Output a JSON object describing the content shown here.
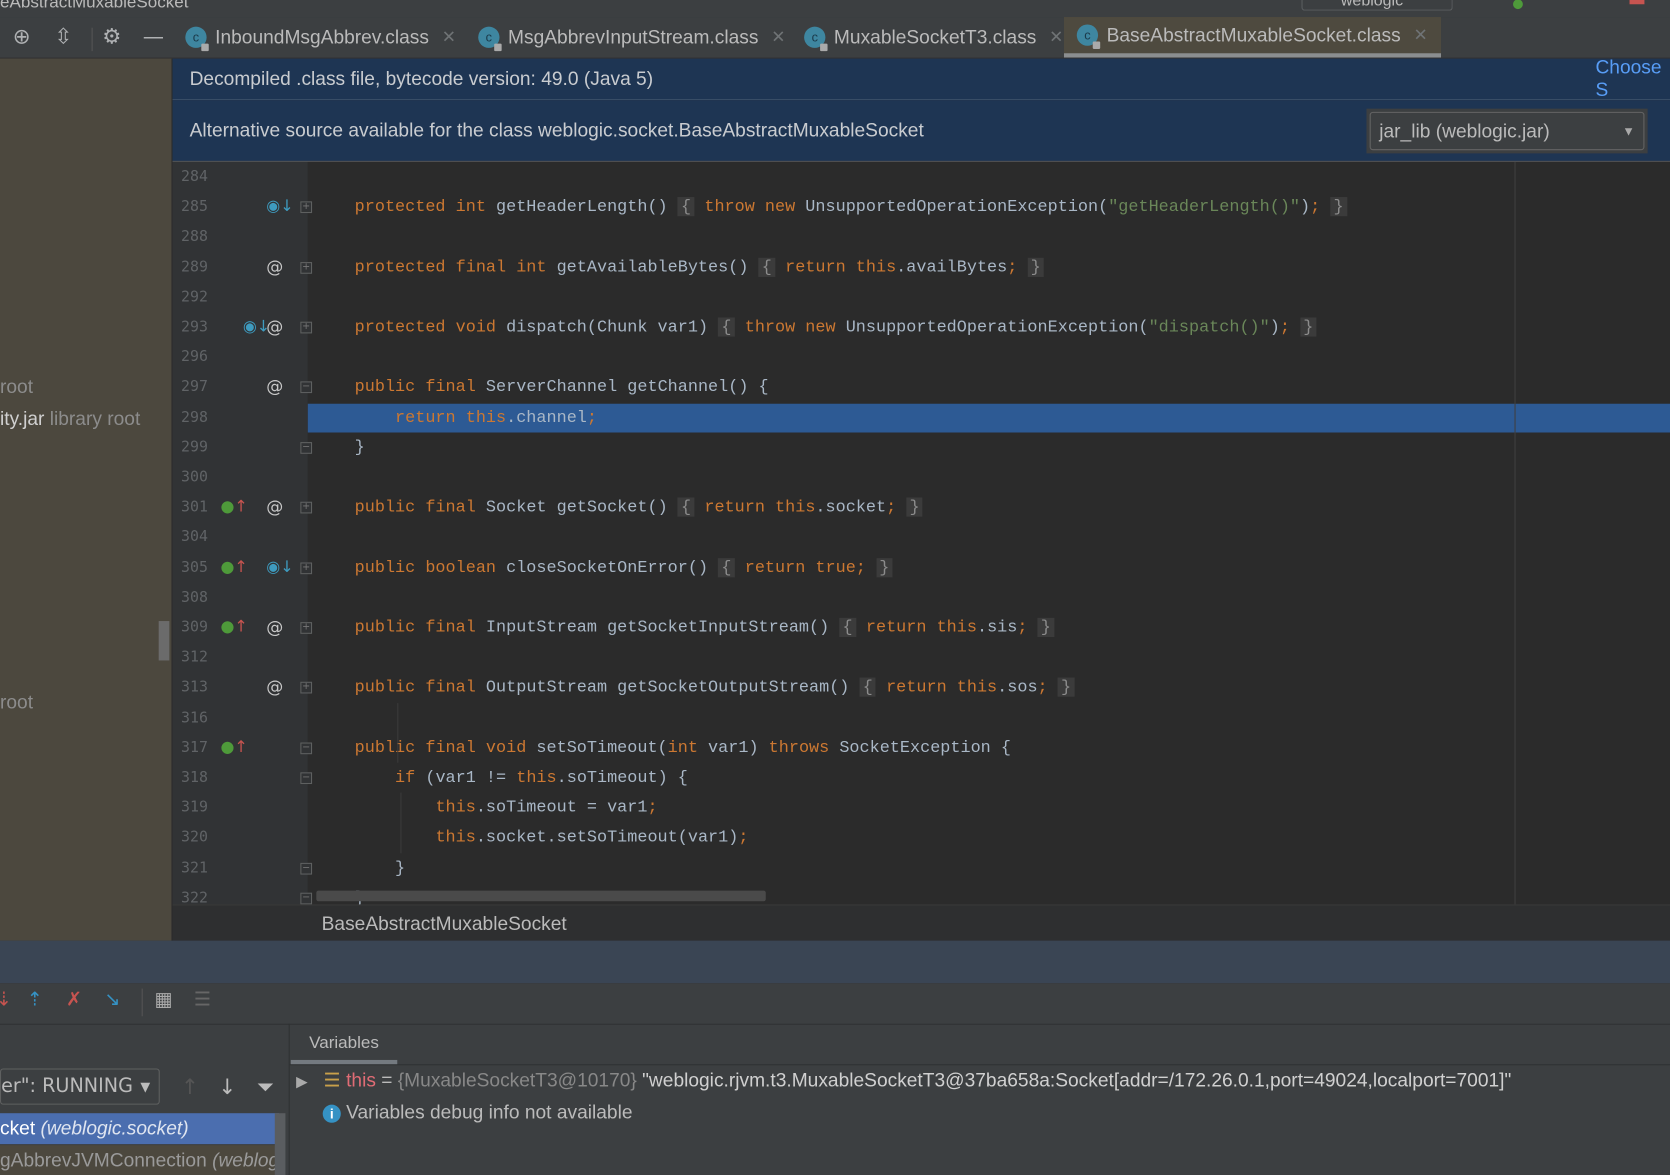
{
  "window": {
    "title": "eAbstractMuxableSocket",
    "run_config": "weblogic"
  },
  "toolbar_left": {
    "icons": [
      "locate-icon",
      "collapse-icon",
      "gear-icon",
      "minimize-icon"
    ]
  },
  "tabs": [
    {
      "label": "InboundMsgAbbrev.class",
      "active": false
    },
    {
      "label": "MsgAbbrevInputStream.class",
      "active": false
    },
    {
      "label": "MuxableSocketT3.class",
      "active": false
    },
    {
      "label": "BaseAbstractMuxableSocket.class",
      "active": true
    }
  ],
  "banner": {
    "decompiled": "Decompiled .class file, bytecode version: 49.0 (Java 5)",
    "choose_link": "Choose S",
    "alternative": "Alternative source available for the class weblogic.socket.BaseAbstractMuxableSocket",
    "source_select": "jar_lib (weblogic.jar)"
  },
  "project_tree": [
    {
      "name": "root",
      "suffix": ""
    },
    {
      "name": "ity.jar",
      "suffix": "library root"
    },
    {
      "name": "root",
      "suffix": ""
    }
  ],
  "code": [
    {
      "n": "284",
      "t": []
    },
    {
      "n": "285",
      "t": [
        [
          "kw",
          "protected int "
        ],
        [
          "pl",
          "getHeaderLength() "
        ],
        [
          "fb",
          "{"
        ],
        [
          "kw",
          " throw new "
        ],
        [
          "pl",
          "UnsupportedOperationException("
        ],
        [
          "str",
          "\"getHeaderLength()\""
        ],
        [
          "pl",
          ")"
        ],
        [
          "kw",
          ";"
        ],
        [
          "pl",
          " "
        ],
        [
          "fb",
          "}"
        ]
      ]
    },
    {
      "n": "288",
      "t": []
    },
    {
      "n": "289",
      "t": [
        [
          "kw",
          "protected final int "
        ],
        [
          "pl",
          "getAvailableBytes() "
        ],
        [
          "fb",
          "{"
        ],
        [
          "kw",
          " return this"
        ],
        [
          "pl",
          ".availBytes"
        ],
        [
          "kw",
          ";"
        ],
        [
          "pl",
          " "
        ],
        [
          "fb",
          "}"
        ]
      ]
    },
    {
      "n": "292",
      "t": []
    },
    {
      "n": "293",
      "t": [
        [
          "kw",
          "protected void "
        ],
        [
          "pl",
          "dispatch(Chunk var1) "
        ],
        [
          "fb",
          "{"
        ],
        [
          "kw",
          " throw new "
        ],
        [
          "pl",
          "UnsupportedOperationException("
        ],
        [
          "str",
          "\"dispatch()\""
        ],
        [
          "pl",
          ")"
        ],
        [
          "kw",
          ";"
        ],
        [
          "pl",
          " "
        ],
        [
          "fb",
          "}"
        ]
      ]
    },
    {
      "n": "296",
      "t": []
    },
    {
      "n": "297",
      "t": [
        [
          "kw",
          "public final "
        ],
        [
          "pl",
          "ServerChannel getChannel() {"
        ]
      ]
    },
    {
      "n": "298",
      "t": [
        [
          "pl",
          "    "
        ],
        [
          "kw",
          "return this"
        ],
        [
          "pl",
          ".channel"
        ],
        [
          "kw",
          ";"
        ]
      ]
    },
    {
      "n": "299",
      "t": [
        [
          "pl",
          "}"
        ]
      ]
    },
    {
      "n": "300",
      "t": []
    },
    {
      "n": "301",
      "t": [
        [
          "kw",
          "public final "
        ],
        [
          "pl",
          "Socket getSocket() "
        ],
        [
          "fb",
          "{"
        ],
        [
          "kw",
          " return this"
        ],
        [
          "pl",
          ".socket"
        ],
        [
          "kw",
          ";"
        ],
        [
          "pl",
          " "
        ],
        [
          "fb",
          "}"
        ]
      ]
    },
    {
      "n": "304",
      "t": []
    },
    {
      "n": "305",
      "t": [
        [
          "kw",
          "public boolean "
        ],
        [
          "pl",
          "closeSocketOnError() "
        ],
        [
          "fb",
          "{"
        ],
        [
          "kw",
          " return true;"
        ],
        [
          "pl",
          " "
        ],
        [
          "fb",
          "}"
        ]
      ]
    },
    {
      "n": "308",
      "t": []
    },
    {
      "n": "309",
      "t": [
        [
          "kw",
          "public final "
        ],
        [
          "pl",
          "InputStream getSocketInputStream() "
        ],
        [
          "fb",
          "{"
        ],
        [
          "kw",
          " return this"
        ],
        [
          "pl",
          ".sis"
        ],
        [
          "kw",
          ";"
        ],
        [
          "pl",
          " "
        ],
        [
          "fb",
          "}"
        ]
      ]
    },
    {
      "n": "312",
      "t": []
    },
    {
      "n": "313",
      "t": [
        [
          "kw",
          "public final "
        ],
        [
          "pl",
          "OutputStream getSocketOutputStream() "
        ],
        [
          "fb",
          "{"
        ],
        [
          "kw",
          " return this"
        ],
        [
          "pl",
          ".sos"
        ],
        [
          "kw",
          ";"
        ],
        [
          "pl",
          " "
        ],
        [
          "fb",
          "}"
        ]
      ]
    },
    {
      "n": "316",
      "t": []
    },
    {
      "n": "317",
      "t": [
        [
          "kw",
          "public final void "
        ],
        [
          "pl",
          "setSoTimeout("
        ],
        [
          "kw",
          "int "
        ],
        [
          "pl",
          "var1) "
        ],
        [
          "kw",
          "throws "
        ],
        [
          "pl",
          "SocketException {"
        ]
      ]
    },
    {
      "n": "318",
      "t": [
        [
          "pl",
          "    "
        ],
        [
          "kw",
          "if "
        ],
        [
          "pl",
          "(var1 != "
        ],
        [
          "kw",
          "this"
        ],
        [
          "pl",
          ".soTimeout) {"
        ]
      ]
    },
    {
      "n": "319",
      "t": [
        [
          "pl",
          "        "
        ],
        [
          "kw",
          "this"
        ],
        [
          "pl",
          ".soTimeout = var1"
        ],
        [
          "kw",
          ";"
        ]
      ]
    },
    {
      "n": "320",
      "t": [
        [
          "pl",
          "        "
        ],
        [
          "kw",
          "this"
        ],
        [
          "pl",
          ".socket.setSoTimeout(var1)"
        ],
        [
          "kw",
          ";"
        ]
      ]
    },
    {
      "n": "321",
      "t": [
        [
          "pl",
          "    }"
        ]
      ]
    },
    {
      "n": "322",
      "t": [
        [
          "pl",
          "}"
        ]
      ]
    }
  ],
  "current_line": "298",
  "breadcrumb": "BaseAbstractMuxableSocket",
  "debugger": {
    "thread_select": "er\": RUNNING",
    "frames": [
      {
        "name": "cket",
        "pkg": "(weblogic.socket)",
        "selected": true
      },
      {
        "name": "gAbbrevJVMConnection",
        "pkg": "(weblog",
        "selected": false
      }
    ],
    "variables_tab": "Variables",
    "variable": {
      "name": "this",
      "eq": " = ",
      "type": "{MuxableSocketT3@10170}",
      "value": " \"weblogic.rjvm.t3.MuxableSocketT3@37ba658a:Socket[addr=/172.26.0.1,port=49024,localport=7001]\""
    },
    "info": "Variables debug info not available"
  },
  "colors": {
    "keyword": "#cc7832",
    "string": "#6a8759",
    "text": "#a9b7c6",
    "selection": "#2d5a94",
    "banner": "#1e3553"
  }
}
